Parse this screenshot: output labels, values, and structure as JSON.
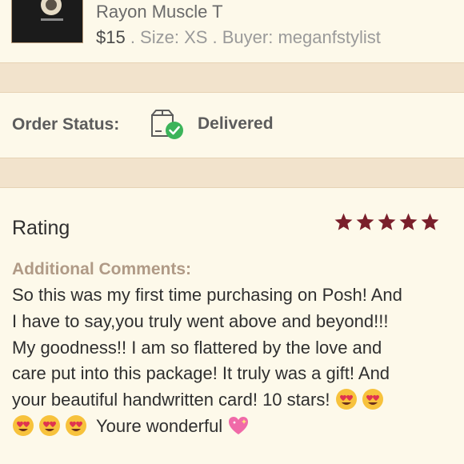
{
  "item": {
    "title": "Rayon Muscle T",
    "price": "$15",
    "meta": " . Size: XS . Buyer: meganfstylist"
  },
  "order": {
    "status_label": "Order Status:",
    "status_value": "Delivered",
    "status_icon": "delivered-box-check-icon"
  },
  "rating": {
    "title": "Rating",
    "stars": 5,
    "star_color": "#7a1f2b",
    "comments_label": "Additional Comments:",
    "comment_lines": [
      "So this was my first time purchasing on Posh! And",
      "I have to say,you truly went above and beyond!!!",
      "My goodness!! I am so flattered by the love and",
      "care put into this package! It truly was a gift! And",
      "your beautiful handwritten card! 10 stars!"
    ],
    "comment_tail": "Youre wonderful"
  },
  "colors": {
    "background": "#fdf9ea",
    "band": "#f2e3cc",
    "check_green": "#3cb45a"
  }
}
